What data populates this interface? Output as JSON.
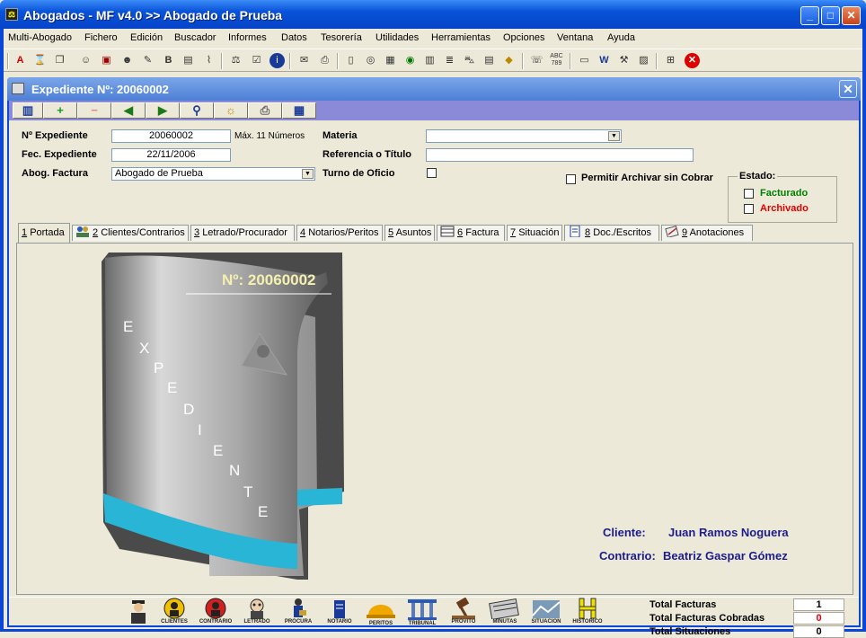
{
  "window": {
    "title": "Abogados - MF v4.0 >> Abogado de Prueba",
    "app_icon": "scales-icon"
  },
  "menu": [
    "Multi-Abogado",
    "Fichero",
    "Edición",
    "Buscador",
    "Informes",
    "Datos",
    "Tesorería",
    "Utilidades",
    "Herramientas",
    "Opciones",
    "Ventana",
    "Ayuda"
  ],
  "child": {
    "title": "Expediente Nº: 20060002"
  },
  "form": {
    "num_label": "Nº Expediente",
    "num_value": "20060002",
    "num_hint": "Máx. 11 Números",
    "fec_label": "Fec. Expediente",
    "fec_value": "22/11/2006",
    "abog_label": "Abog. Factura",
    "abog_value": "Abogado de Prueba",
    "materia_label": "Materia",
    "materia_value": "",
    "ref_label": "Referencia o Título",
    "ref_value": "",
    "turno_label": "Turno de Oficio",
    "permitir_label": "Permitir Archivar sin Cobrar",
    "estado_label": "Estado:",
    "facturado_label": "Facturado",
    "archivado_label": "Archivado",
    "facturado_color": "#008000",
    "archivado_color": "#E00000"
  },
  "tabs": [
    {
      "num": "1",
      "label": "Portada"
    },
    {
      "num": "2",
      "label": "Clientes/Contrarios"
    },
    {
      "num": "3",
      "label": "Letrado/Procurador"
    },
    {
      "num": "4",
      "label": "Notarios/Peritos"
    },
    {
      "num": "5",
      "label": "Asuntos"
    },
    {
      "num": "6",
      "label": "Factura"
    },
    {
      "num": "7",
      "label": "Situación"
    },
    {
      "num": "8",
      "label": "Doc./Escritos"
    },
    {
      "num": "9",
      "label": "Anotaciones"
    }
  ],
  "cover": {
    "number": "Nº: 20060002",
    "word_letters": [
      "E",
      "X",
      "P",
      "E",
      "D",
      "I",
      "E",
      "N",
      "T",
      "E"
    ]
  },
  "parties": {
    "cliente_label": "Cliente:",
    "cliente_value": "Juan Ramos Noguera",
    "contrario_label": "Contrario:",
    "contrario_value": "Beatriz Gaspar Gómez"
  },
  "bottom_icons": [
    {
      "name": "graduate-icon",
      "caption": ""
    },
    {
      "name": "clientes-icon",
      "caption": "CLIENTES"
    },
    {
      "name": "contrario-icon",
      "caption": "CONTRARIO"
    },
    {
      "name": "letrado-icon",
      "caption": "LETRADO"
    },
    {
      "name": "procura-icon",
      "caption": "PROCURA"
    },
    {
      "name": "notario-icon",
      "caption": "NOTARIO"
    },
    {
      "name": "peritos-icon",
      "caption": "PERITOS"
    },
    {
      "name": "tribunal-icon",
      "caption": "TRIBUNAL"
    },
    {
      "name": "provito-icon",
      "caption": "PROVITO"
    },
    {
      "name": "minutas-icon",
      "caption": "MINUTAS"
    },
    {
      "name": "situacion-icon",
      "caption": "SITUACION"
    },
    {
      "name": "historico-icon",
      "caption": "HISTORICO"
    }
  ],
  "totals": {
    "facturas_label": "Total Facturas",
    "facturas_value": "1",
    "cobradas_label": "Total Facturas Cobradas",
    "cobradas_value": "0",
    "situaciones_label": "Total Situaciones",
    "situaciones_value": "0"
  }
}
